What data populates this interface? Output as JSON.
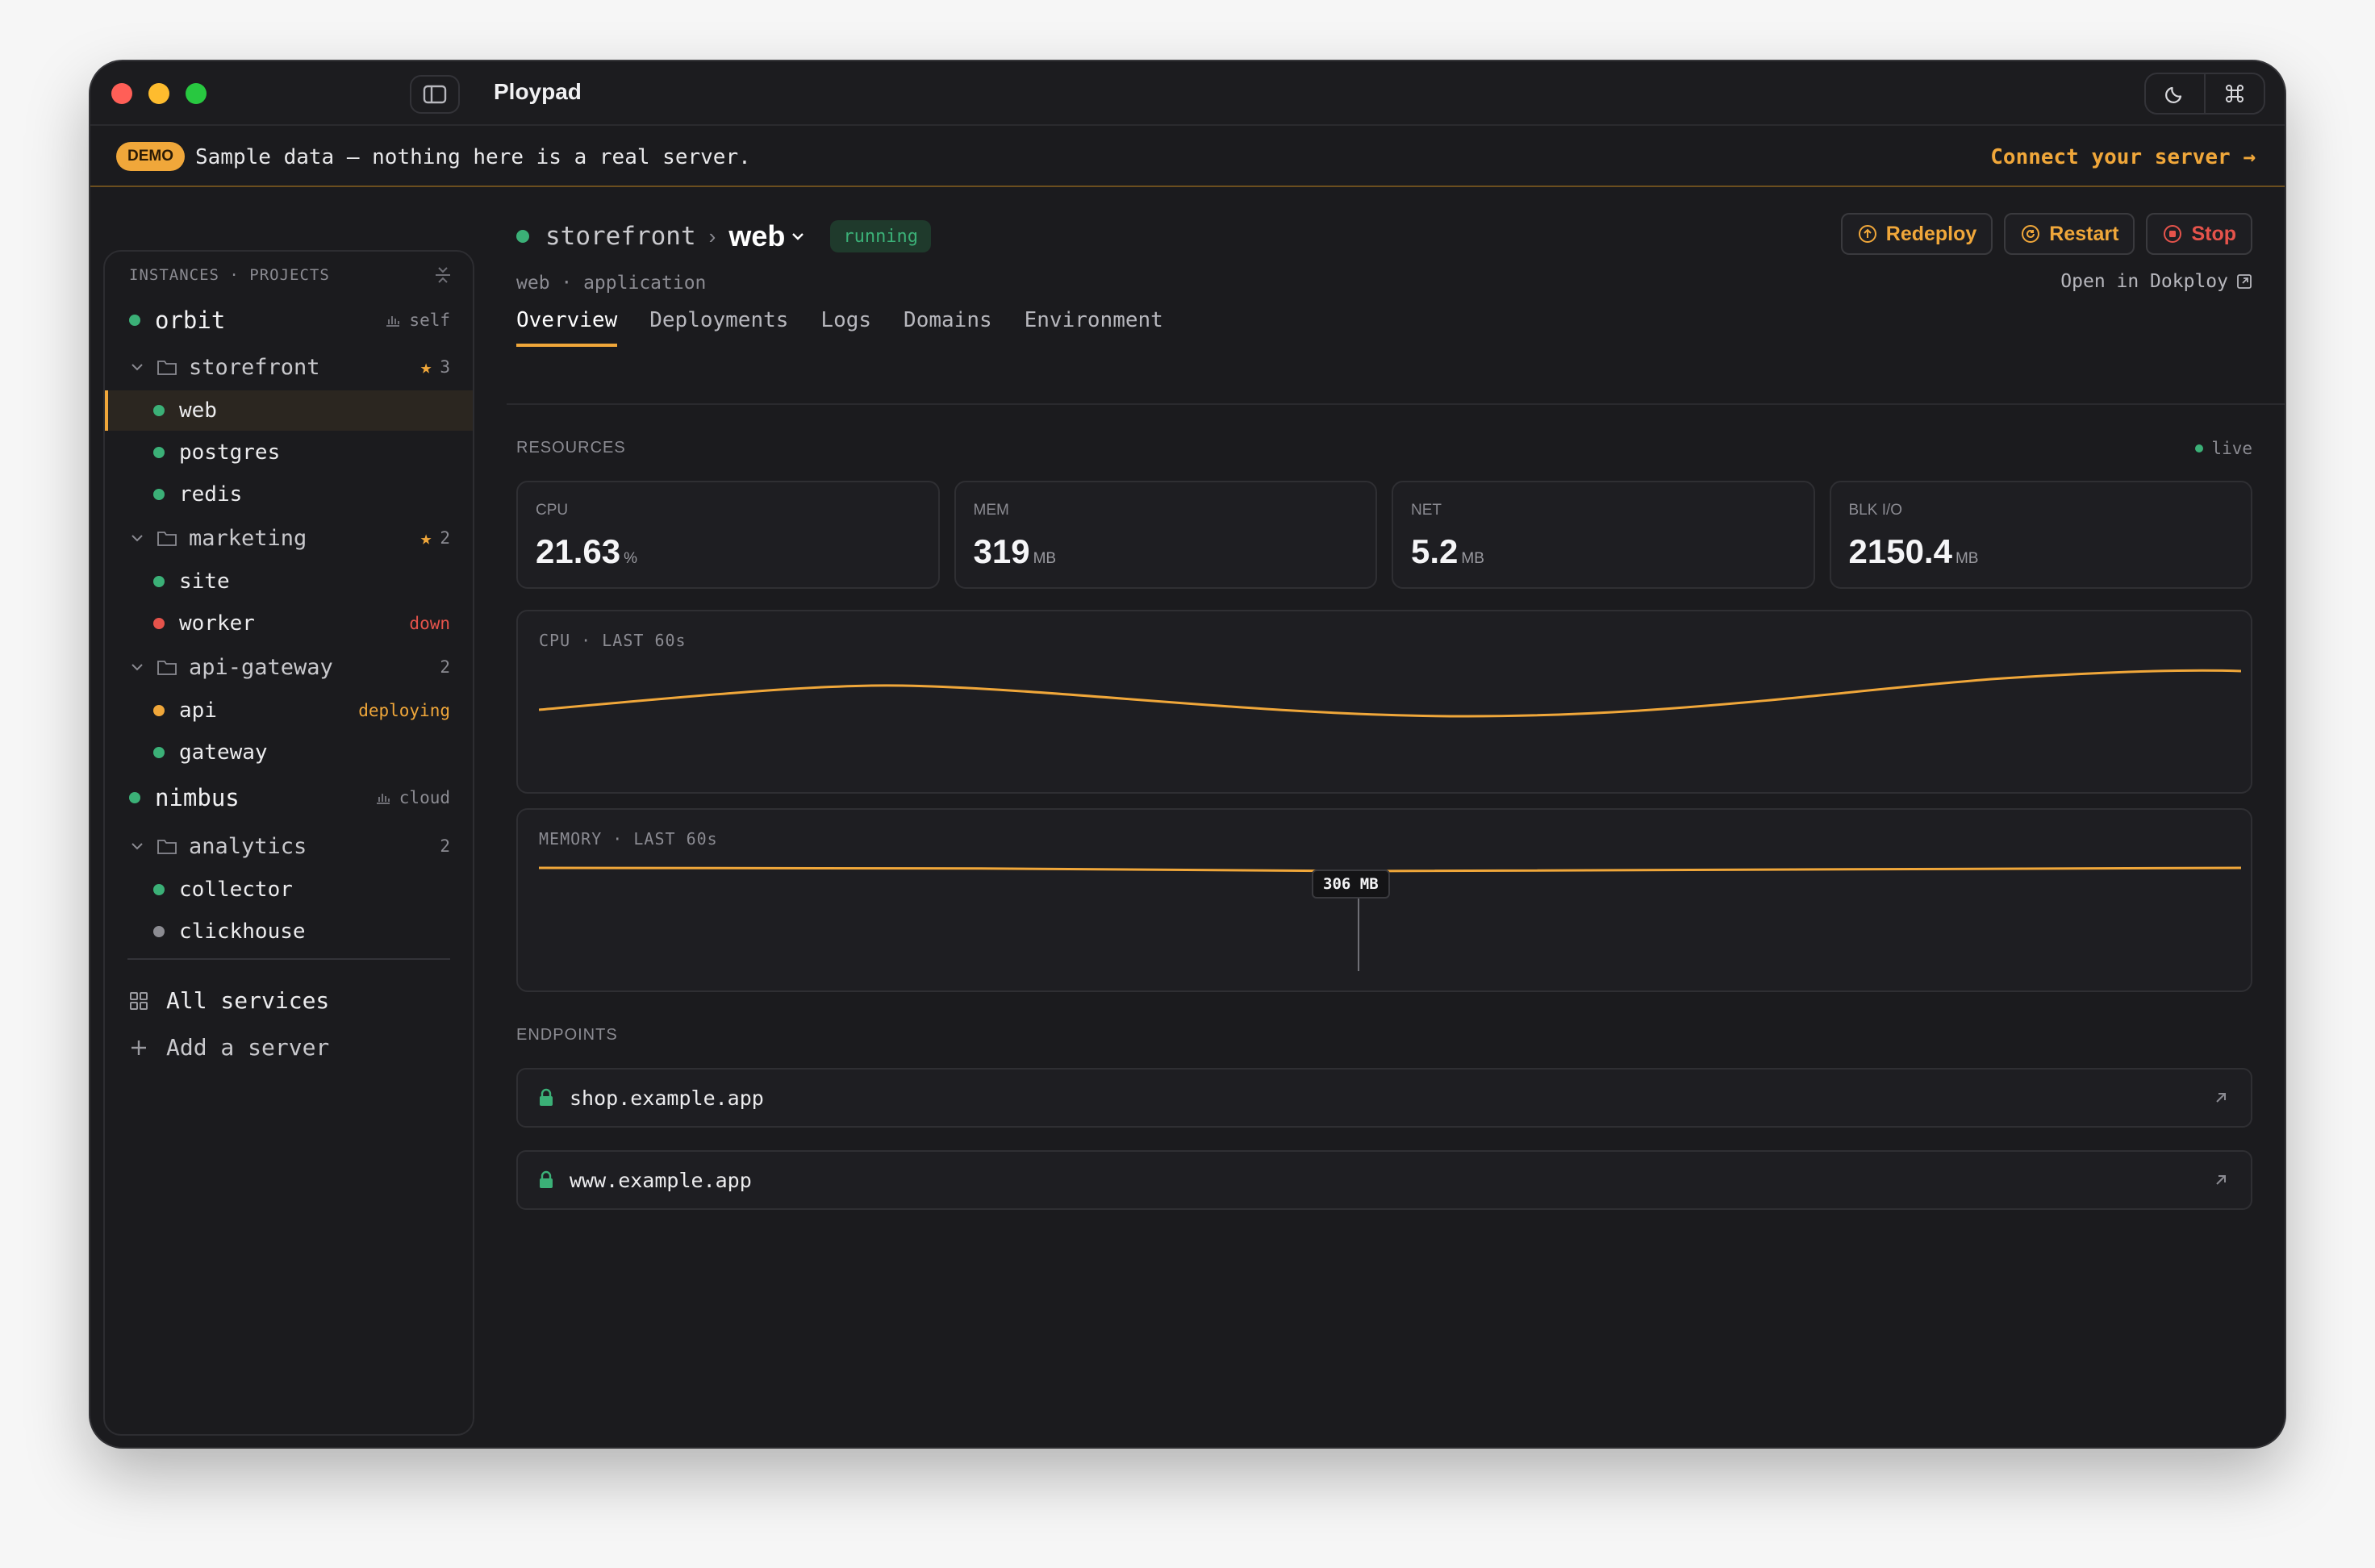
{
  "app": {
    "title": "Ploypad"
  },
  "banner": {
    "badge": "DEMO",
    "text": "Sample data — nothing here is a real server.",
    "link": "Connect your server →"
  },
  "sidebar": {
    "header": "INSTANCES · PROJECTS",
    "servers": [
      {
        "name": "orbit",
        "tag": "self",
        "status": "green"
      },
      {
        "name": "nimbus",
        "tag": "cloud",
        "status": "green"
      }
    ],
    "projects": [
      {
        "name": "storefront",
        "count": "3",
        "starred": true
      },
      {
        "name": "marketing",
        "count": "2",
        "starred": true
      },
      {
        "name": "api-gateway",
        "count": "2",
        "starred": false
      },
      {
        "name": "analytics",
        "count": "2",
        "starred": false
      }
    ],
    "services": [
      {
        "name": "web",
        "status": "green",
        "note": ""
      },
      {
        "name": "postgres",
        "status": "green",
        "note": ""
      },
      {
        "name": "redis",
        "status": "green",
        "note": ""
      },
      {
        "name": "site",
        "status": "green",
        "note": ""
      },
      {
        "name": "worker",
        "status": "red",
        "note": "down"
      },
      {
        "name": "api",
        "status": "orange",
        "note": "deploying"
      },
      {
        "name": "gateway",
        "status": "green",
        "note": ""
      },
      {
        "name": "collector",
        "status": "green",
        "note": ""
      },
      {
        "name": "clickhouse",
        "status": "gray",
        "note": ""
      }
    ],
    "all_services": "All services",
    "add_server": "Add a server"
  },
  "main": {
    "breadcrumb_parent": "storefront",
    "breadcrumb_current": "web",
    "status": "running",
    "subline": "web · application",
    "actions": {
      "redeploy": "Redeploy",
      "restart": "Restart",
      "stop": "Stop"
    },
    "open_link": "Open in Dokploy",
    "tabs": [
      "Overview",
      "Deployments",
      "Logs",
      "Domains",
      "Environment"
    ],
    "active_tab": "Overview",
    "resources_label": "RESOURCES",
    "live_label": "live",
    "metrics": [
      {
        "label": "CPU",
        "value": "21.63",
        "unit": "%"
      },
      {
        "label": "MEM",
        "value": "319",
        "unit": "MB"
      },
      {
        "label": "NET",
        "value": "5.2",
        "unit": "MB"
      },
      {
        "label": "BLK I/O",
        "value": "2150.4",
        "unit": "MB"
      }
    ],
    "cpu_chart_label": "CPU · LAST 60s",
    "memory_chart_label": "MEMORY · LAST 60s",
    "memory_tooltip": "306 MB",
    "endpoints_label": "ENDPOINTS",
    "endpoints": [
      "shop.example.app",
      "www.example.app"
    ]
  },
  "colors": {
    "accent": "#f0a73a",
    "ok": "#3bb077",
    "error": "#e5534b",
    "muted": "#8c8c92"
  }
}
